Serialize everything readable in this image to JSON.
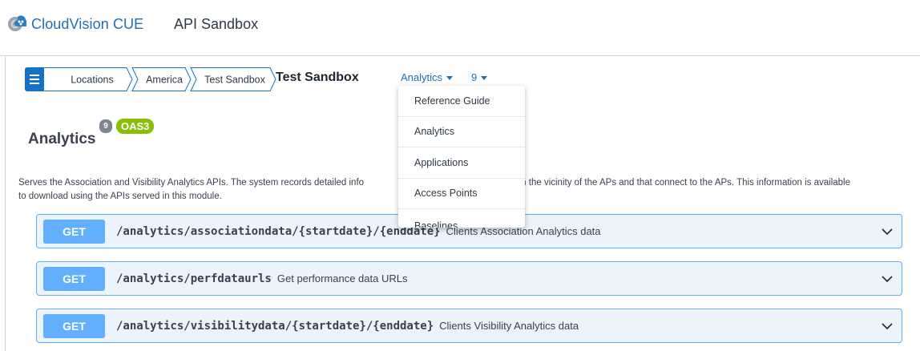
{
  "header": {
    "brand_name": "CloudVision",
    "brand_suffix": "CUE",
    "app_title": "API Sandbox"
  },
  "breadcrumb": {
    "items": [
      "Locations",
      "America",
      "Test Sandbox"
    ],
    "current": "Test Sandbox"
  },
  "nav_dropdowns": {
    "module": "Analytics",
    "count": "9"
  },
  "section": {
    "title": "Analytics",
    "version_badge": "9",
    "spec_badge": "OAS3",
    "description_line1_start": "Serves the Association and Visibility Analytics APIs. The system records detailed info",
    "description_line1_end": "ome in the vicinity of the APs and that connect to the APs. This information is available",
    "description_line2": "to download using the APIs served in this module."
  },
  "operations": [
    {
      "method": "GET",
      "path": "/analytics/associationdata/{startdate}/{enddate}",
      "summary": "Clients Association Analytics data"
    },
    {
      "method": "GET",
      "path": "/analytics/perfdataurls",
      "summary": "Get performance data URLs"
    },
    {
      "method": "GET",
      "path": "/analytics/visibilitydata/{startdate}/{enddate}",
      "summary": "Clients Visibility Analytics data"
    }
  ],
  "dropdown_menu": {
    "items": [
      "Reference Guide",
      "Analytics",
      "Applications",
      "Access Points",
      "Baselines"
    ]
  },
  "icons": {
    "menu": "hamburger-icon",
    "brand": "cloudvision-logo-icon",
    "expand": "chevron-down-icon",
    "dropdown": "caret-down-icon"
  },
  "colors": {
    "accent_blue": "#1473c8",
    "get_method": "#61affe",
    "get_background": "#ebf3fb",
    "oas_badge": "#89bf04",
    "version_badge": "#7d8492"
  }
}
